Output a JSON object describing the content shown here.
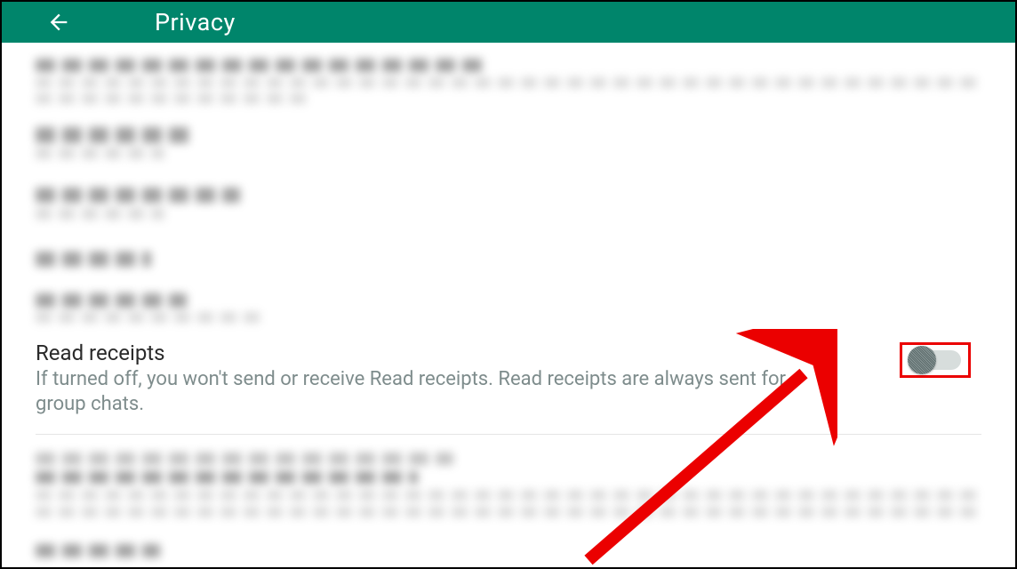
{
  "header": {
    "title": "Privacy"
  },
  "read_receipts": {
    "title": "Read receipts",
    "description": "If turned off, you won't send or receive Read receipts. Read receipts are always sent for group chats.",
    "toggle_state": "off"
  }
}
